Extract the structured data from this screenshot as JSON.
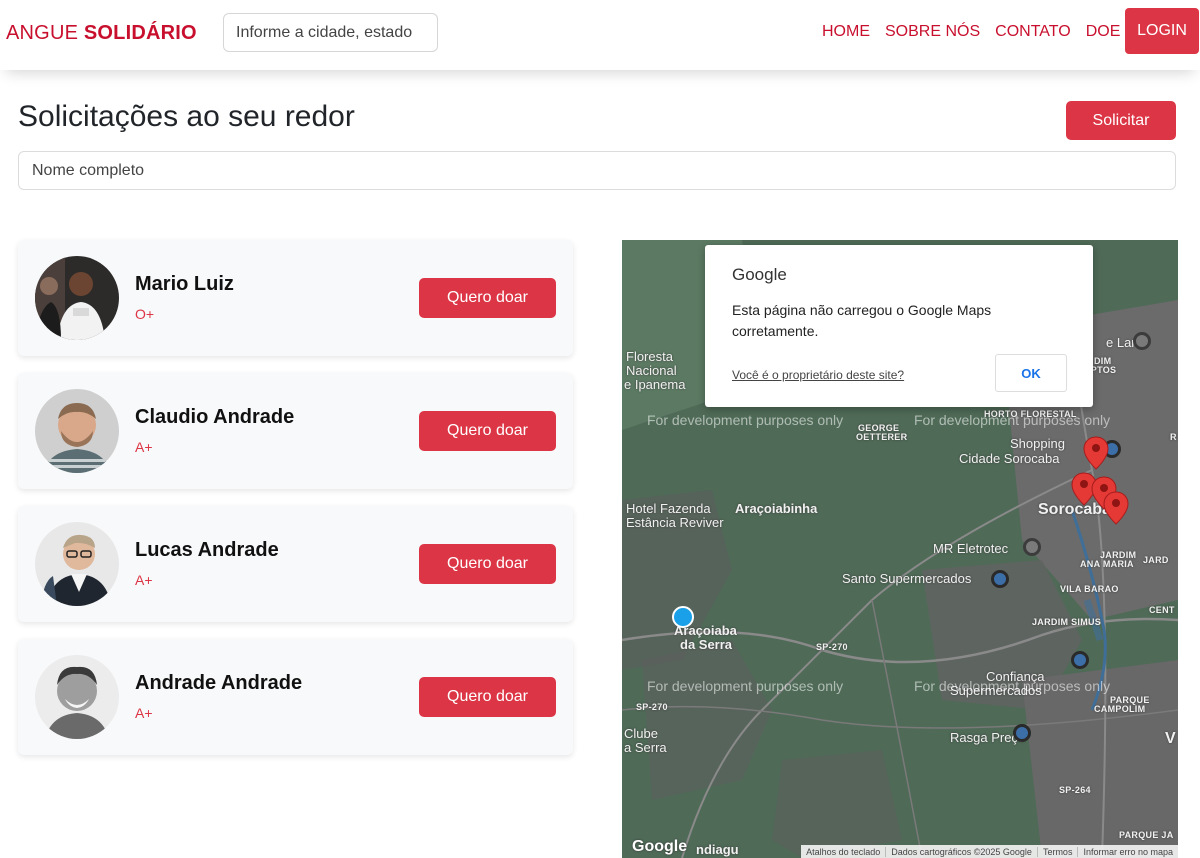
{
  "navbar": {
    "brand_part1": "ANGUE ",
    "brand_part2": "SOLIDÁRIO",
    "city_placeholder": "Informe a cidade, estado",
    "links": [
      "HOME",
      "SOBRE NÓS",
      "CONTATO",
      "DOE"
    ],
    "login_label": "LOGIN"
  },
  "header": {
    "title": "Solicitações ao seu redor",
    "request_button": "Solicitar",
    "name_placeholder": "Nome completo"
  },
  "requests": [
    {
      "name": "Mario Luiz",
      "blood_type": "O+",
      "button": "Quero doar"
    },
    {
      "name": "Claudio Andrade",
      "blood_type": "A+",
      "button": "Quero doar"
    },
    {
      "name": "Lucas Andrade",
      "blood_type": "A+",
      "button": "Quero doar"
    },
    {
      "name": "Andrade Andrade",
      "blood_type": "A+",
      "button": "Quero doar"
    }
  ],
  "map": {
    "dialog": {
      "brand": "Google",
      "message": "Esta página não carregou o Google Maps corretamente.",
      "owner_link": "Você é o proprietário deste site?",
      "ok_label": "OK"
    },
    "watermark": "For development purposes only",
    "labels": {
      "floresta": "Floresta",
      "nacional": "Nacional",
      "ipanema": "e Ipanema",
      "hotel1": "Hotel Fazenda",
      "hotel2": "Estância Reviver",
      "aracoiabinha": "Araçoiabinha",
      "george": "GEORGE",
      "oetterer": "OETTERER",
      "horto": "HORTO FLORESTAL",
      "shopping1": "Shopping",
      "shopping2": "Cidade Sorocaba",
      "sorocaba": "Sorocaba",
      "mr": "MR Eletrotec",
      "santo": "Santo Supermercados",
      "jardim_ana1": "JARDIM",
      "jardim_ana2": "ANA MARIA",
      "jard": "JARD",
      "vila_barao": "VILA BARAO",
      "cent": "CENT",
      "jardim_simus": "JARDIM SIMUS",
      "aracoiaba1": "Araçoiaba",
      "aracoiaba2": "da Serra",
      "sp270a": "SP-270",
      "sp270b": "SP-270",
      "confianca1": "Confiança",
      "confianca2": "Supermercados",
      "parque1": "PARQUE",
      "parque2": "CAMPOLIM",
      "clube1": "Clube",
      "clube2": "a Serra",
      "rasga": "Rasga Preço",
      "sp264": "SP-264",
      "lar": "e Lar",
      "dim": "DIM",
      "iptos": "IPTOS",
      "v": "V",
      "r": "R",
      "parque_ja": "PARQUE JA",
      "ndiagu": "ndiagu"
    },
    "footer": {
      "logo": "Google",
      "items": [
        "Atalhos do teclado",
        "Dados cartográficos ©2025 Google",
        "Termos",
        "Informar erro no mapa"
      ]
    },
    "colors": {
      "land": "#4f6a57",
      "urban": "#6b6b6b",
      "pin": "#e53935",
      "location_dot": "#1aa0e8"
    }
  }
}
